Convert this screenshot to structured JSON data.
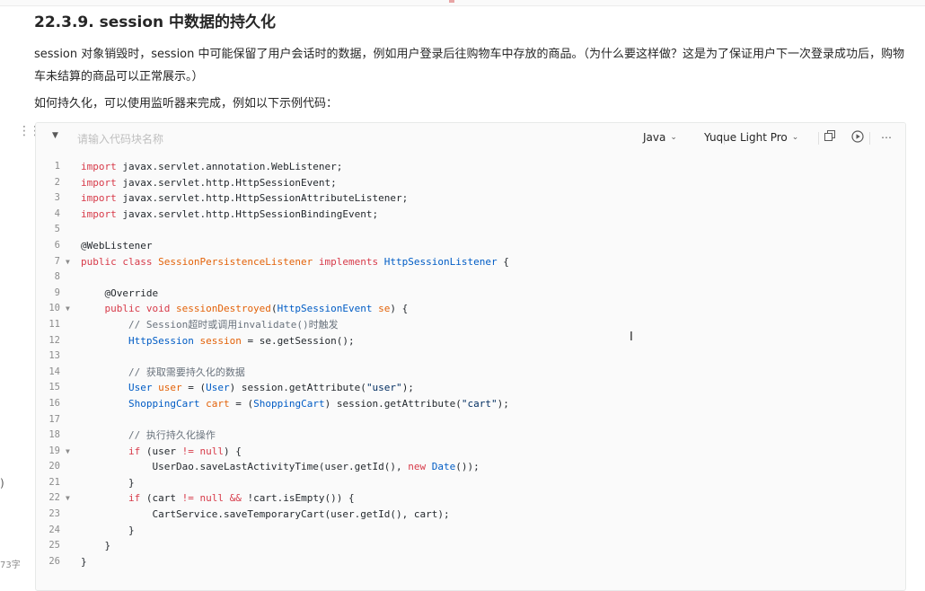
{
  "heading": "22.3.9. session 中数据的持久化",
  "paragraphs": [
    "session 对象销毁时，session 中可能保留了用户会话时的数据，例如用户登录后往购物车中存放的商品。（为什么要这样做？这是为了保证用户下一次登录成功后，购物车未结算的商品可以正常展示。）",
    "如何持久化，可以使用监听器来完成，例如以下示例代码："
  ],
  "left_gutter": {
    "mark": ")",
    "word_count": "73字"
  },
  "code_block": {
    "name_placeholder": "请输入代码块名称",
    "language": "Java",
    "theme": "Yuque Light Pro",
    "icons": [
      "chevron-down-icon",
      "copy-icon",
      "run-icon",
      "more-icon"
    ],
    "colors": {
      "keyword": "#d73a49",
      "type": "#005cc5",
      "string": "#032f62",
      "comment": "#6a737d",
      "function": "#e36209",
      "annotation": "#24292e",
      "plain": "#24292e"
    },
    "lines": [
      {
        "n": "1",
        "fold": false,
        "tokens": [
          {
            "t": "import",
            "c": "keyword"
          },
          {
            "t": " javax.servlet.annotation.",
            "c": "plain"
          },
          {
            "t": "WebListener",
            "c": "plain"
          },
          {
            "t": ";",
            "c": "plain"
          }
        ]
      },
      {
        "n": "2",
        "fold": false,
        "tokens": [
          {
            "t": "import",
            "c": "keyword"
          },
          {
            "t": " javax.servlet.http.HttpSessionEvent;",
            "c": "plain"
          }
        ]
      },
      {
        "n": "3",
        "fold": false,
        "tokens": [
          {
            "t": "import",
            "c": "keyword"
          },
          {
            "t": " javax.servlet.http.HttpSessionAttributeListener;",
            "c": "plain"
          }
        ]
      },
      {
        "n": "4",
        "fold": false,
        "tokens": [
          {
            "t": "import",
            "c": "keyword"
          },
          {
            "t": " javax.servlet.http.HttpSessionBindingEvent;",
            "c": "plain"
          }
        ]
      },
      {
        "n": "5",
        "fold": false,
        "tokens": []
      },
      {
        "n": "6",
        "fold": false,
        "tokens": [
          {
            "t": "@WebListener",
            "c": "annotation"
          }
        ]
      },
      {
        "n": "7",
        "fold": true,
        "tokens": [
          {
            "t": "public class ",
            "c": "keyword"
          },
          {
            "t": "SessionPersistenceListener",
            "c": "function"
          },
          {
            "t": " implements ",
            "c": "keyword"
          },
          {
            "t": "HttpSessionListener",
            "c": "type"
          },
          {
            "t": " {",
            "c": "plain"
          }
        ]
      },
      {
        "n": "8",
        "fold": false,
        "tokens": []
      },
      {
        "n": "9",
        "fold": false,
        "tokens": [
          {
            "t": "    @Override",
            "c": "annotation"
          }
        ]
      },
      {
        "n": "10",
        "fold": true,
        "tokens": [
          {
            "t": "    public void ",
            "c": "keyword"
          },
          {
            "t": "sessionDestroyed",
            "c": "function"
          },
          {
            "t": "(",
            "c": "plain"
          },
          {
            "t": "HttpSessionEvent",
            "c": "type"
          },
          {
            "t": " se",
            "c": "function"
          },
          {
            "t": ") {",
            "c": "plain"
          }
        ]
      },
      {
        "n": "11",
        "fold": false,
        "tokens": [
          {
            "t": "        // Session超时或调用invalidate()时触发",
            "c": "comment"
          }
        ]
      },
      {
        "n": "12",
        "fold": false,
        "tokens": [
          {
            "t": "        ",
            "c": "plain"
          },
          {
            "t": "HttpSession",
            "c": "type"
          },
          {
            "t": " session",
            "c": "function"
          },
          {
            "t": " = se.getSession();",
            "c": "plain"
          }
        ]
      },
      {
        "n": "13",
        "fold": false,
        "tokens": []
      },
      {
        "n": "14",
        "fold": false,
        "tokens": [
          {
            "t": "        // 获取需要持久化的数据",
            "c": "comment"
          }
        ]
      },
      {
        "n": "15",
        "fold": false,
        "tokens": [
          {
            "t": "        ",
            "c": "plain"
          },
          {
            "t": "User",
            "c": "type"
          },
          {
            "t": " user",
            "c": "function"
          },
          {
            "t": " = (",
            "c": "plain"
          },
          {
            "t": "User",
            "c": "type"
          },
          {
            "t": ") session.getAttribute(",
            "c": "plain"
          },
          {
            "t": "\"user\"",
            "c": "string"
          },
          {
            "t": ");",
            "c": "plain"
          }
        ]
      },
      {
        "n": "16",
        "fold": false,
        "tokens": [
          {
            "t": "        ",
            "c": "plain"
          },
          {
            "t": "ShoppingCart",
            "c": "type"
          },
          {
            "t": " cart",
            "c": "function"
          },
          {
            "t": " = (",
            "c": "plain"
          },
          {
            "t": "ShoppingCart",
            "c": "type"
          },
          {
            "t": ") session.getAttribute(",
            "c": "plain"
          },
          {
            "t": "\"cart\"",
            "c": "string"
          },
          {
            "t": ");",
            "c": "plain"
          }
        ]
      },
      {
        "n": "17",
        "fold": false,
        "tokens": []
      },
      {
        "n": "18",
        "fold": false,
        "tokens": [
          {
            "t": "        // 执行持久化操作",
            "c": "comment"
          }
        ]
      },
      {
        "n": "19",
        "fold": true,
        "tokens": [
          {
            "t": "        ",
            "c": "plain"
          },
          {
            "t": "if",
            "c": "keyword"
          },
          {
            "t": " (user ",
            "c": "plain"
          },
          {
            "t": "!=",
            "c": "keyword"
          },
          {
            "t": " ",
            "c": "plain"
          },
          {
            "t": "null",
            "c": "keyword"
          },
          {
            "t": ") {",
            "c": "plain"
          }
        ]
      },
      {
        "n": "20",
        "fold": false,
        "tokens": [
          {
            "t": "            UserDao.saveLastActivityTime(user.getId(), ",
            "c": "plain"
          },
          {
            "t": "new",
            "c": "keyword"
          },
          {
            "t": " ",
            "c": "plain"
          },
          {
            "t": "Date",
            "c": "type"
          },
          {
            "t": "());",
            "c": "plain"
          }
        ]
      },
      {
        "n": "21",
        "fold": false,
        "tokens": [
          {
            "t": "        }",
            "c": "plain"
          }
        ]
      },
      {
        "n": "22",
        "fold": true,
        "tokens": [
          {
            "t": "        ",
            "c": "plain"
          },
          {
            "t": "if",
            "c": "keyword"
          },
          {
            "t": " (cart ",
            "c": "plain"
          },
          {
            "t": "!=",
            "c": "keyword"
          },
          {
            "t": " ",
            "c": "plain"
          },
          {
            "t": "null",
            "c": "keyword"
          },
          {
            "t": " ",
            "c": "plain"
          },
          {
            "t": "&&",
            "c": "keyword"
          },
          {
            "t": " !cart.isEmpty()) {",
            "c": "plain"
          }
        ]
      },
      {
        "n": "23",
        "fold": false,
        "tokens": [
          {
            "t": "            CartService.saveTemporaryCart(user.getId(), cart);",
            "c": "plain"
          }
        ]
      },
      {
        "n": "24",
        "fold": false,
        "tokens": [
          {
            "t": "        }",
            "c": "plain"
          }
        ]
      },
      {
        "n": "25",
        "fold": false,
        "tokens": [
          {
            "t": "    }",
            "c": "plain"
          }
        ]
      },
      {
        "n": "26",
        "fold": false,
        "tokens": [
          {
            "t": "}",
            "c": "plain"
          }
        ]
      }
    ]
  }
}
